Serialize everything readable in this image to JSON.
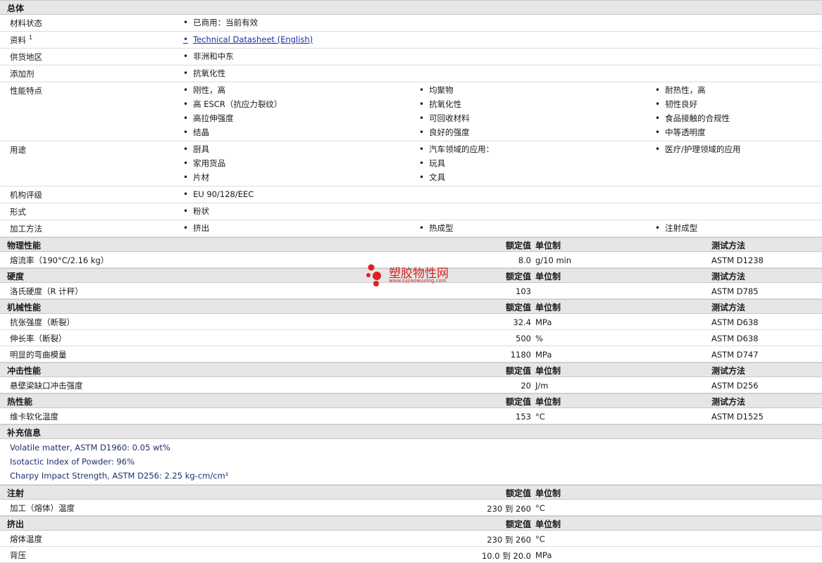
{
  "general": {
    "title": "总体",
    "rows": [
      {
        "label": "材料状态",
        "cols": [
          [
            "已商用：当前有效"
          ]
        ]
      },
      {
        "label": "资料",
        "sup": "1",
        "cols": [
          [
            "Technical Datasheet (English)"
          ]
        ],
        "link": true
      },
      {
        "label": "供货地区",
        "cols": [
          [
            "非洲和中东"
          ]
        ]
      },
      {
        "label": "添加剂",
        "cols": [
          [
            "抗氧化性"
          ]
        ]
      },
      {
        "label": "性能特点",
        "cols": [
          [
            "刚性，高",
            "高 ESCR（抗应力裂纹）",
            "高拉伸强度",
            "结晶"
          ],
          [
            "均聚物",
            "抗氧化性",
            "可回收材料",
            "良好的强度"
          ],
          [
            "耐热性，高",
            "韧性良好",
            "食品接触的合规性",
            "中等透明度"
          ]
        ]
      },
      {
        "label": "用途",
        "cols": [
          [
            "厨具",
            "家用货品",
            "片材"
          ],
          [
            "汽车领域的应用：",
            "玩具",
            "文具"
          ],
          [
            "医疗/护理领域的应用"
          ]
        ]
      },
      {
        "label": "机构评级",
        "cols": [
          [
            "EU 90/128/EEC"
          ]
        ]
      },
      {
        "label": "形式",
        "cols": [
          [
            "粉状"
          ]
        ]
      },
      {
        "label": "加工方法",
        "cols": [
          [
            "挤出"
          ],
          [
            "热成型"
          ],
          [
            "注射成型"
          ]
        ]
      }
    ]
  },
  "headers": {
    "value": "额定值",
    "unit": "单位制",
    "test": "测试方法"
  },
  "sections": [
    {
      "title": "物理性能",
      "show_test": true,
      "rows": [
        {
          "label": "熔流率（190°C/2.16 kg）",
          "value": "8.0",
          "unit": "g/10 min",
          "test": "ASTM D1238"
        }
      ]
    },
    {
      "title": "硬度",
      "show_test": true,
      "rows": [
        {
          "label": "洛氏硬度（R 计秤）",
          "value": "103",
          "unit": "",
          "test": "ASTM D785"
        }
      ]
    },
    {
      "title": "机械性能",
      "show_test": true,
      "rows": [
        {
          "label": "抗张强度（断裂）",
          "value": "32.4",
          "unit": "MPa",
          "test": "ASTM D638"
        },
        {
          "label": "伸长率（断裂）",
          "value": "500",
          "unit": "%",
          "test": "ASTM D638"
        },
        {
          "label": "明显的弯曲模量",
          "value": "1180",
          "unit": "MPa",
          "test": "ASTM D747"
        }
      ]
    },
    {
      "title": "冲击性能",
      "show_test": true,
      "rows": [
        {
          "label": "悬壁梁缺口冲击强度",
          "value": "20",
          "unit": "J/m",
          "test": "ASTM D256"
        }
      ]
    },
    {
      "title": "热性能",
      "show_test": true,
      "rows": [
        {
          "label": "维卡软化温度",
          "value": "153",
          "unit": "°C",
          "test": "ASTM D1525"
        }
      ]
    }
  ],
  "supplement": {
    "title": "补充信息",
    "notes": [
      "Volatile matter, ASTM D1960: 0.05 wt%",
      "Isotactic Index of Powder: 96%",
      "Charpy Impact Strength, ASTM D256: 2.25 kg-cm/cm²"
    ]
  },
  "sections2": [
    {
      "title": "注射",
      "show_test": false,
      "rows": [
        {
          "label": "加工（熔体）温度",
          "value": "230 到  260",
          "unit": "°C",
          "test": ""
        }
      ]
    },
    {
      "title": "挤出",
      "show_test": false,
      "rows": [
        {
          "label": "熔体温度",
          "value": "230 到  260",
          "unit": "°C",
          "test": ""
        },
        {
          "label": "背压",
          "value": "10.0 到  20.0",
          "unit": "MPa",
          "test": ""
        }
      ]
    }
  ],
  "watermark": {
    "cn": "塑胶物性网",
    "url": "www.sujiaowuxing.com"
  }
}
